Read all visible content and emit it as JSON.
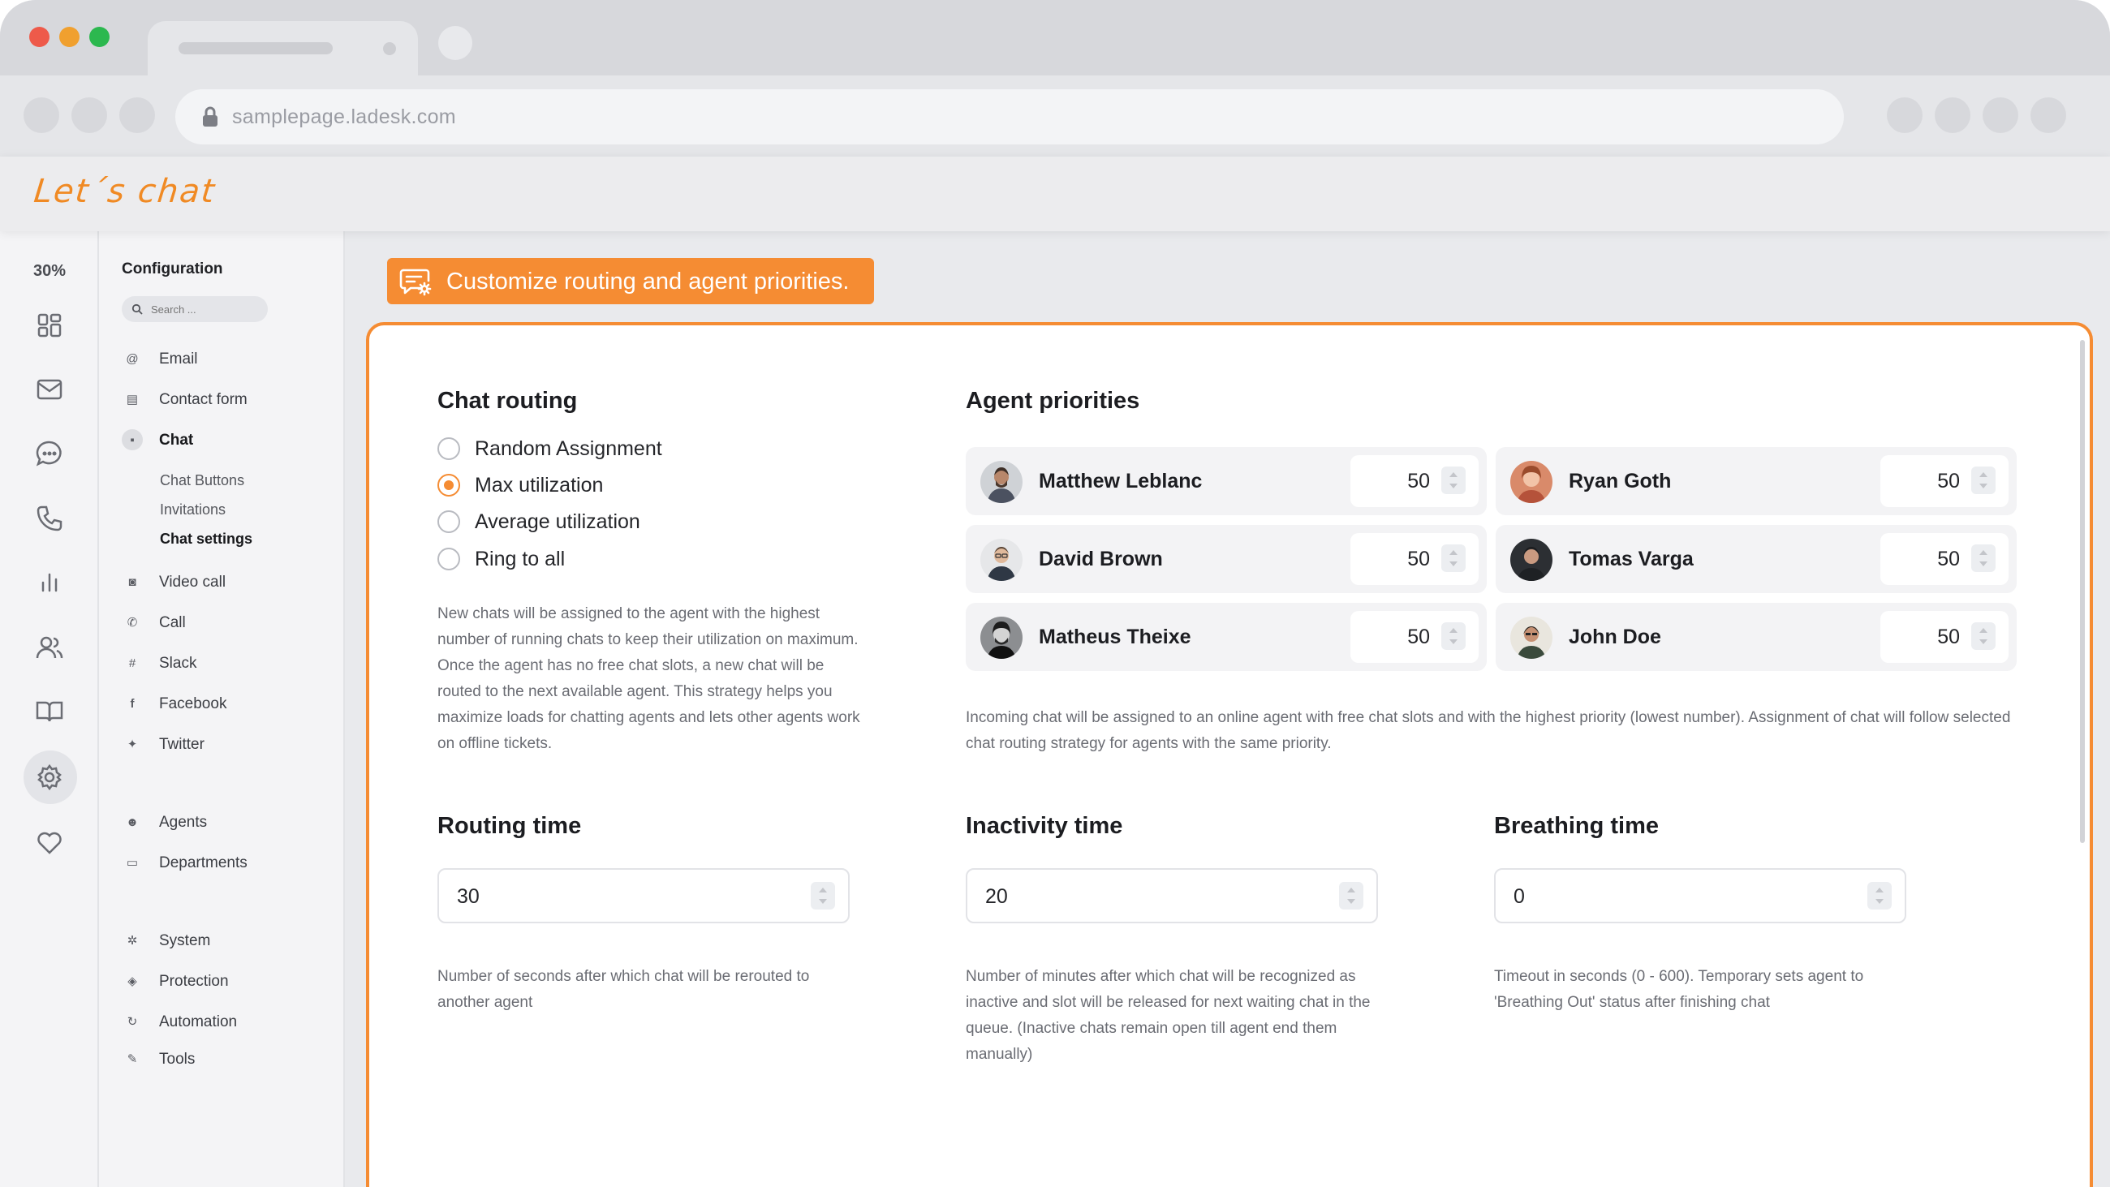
{
  "browser": {
    "url": "samplepage.ladesk.com",
    "traffic_colors": [
      "#ee5a4a",
      "#f0a02f",
      "#2cb84f"
    ]
  },
  "app": {
    "logo": "Let´s chat"
  },
  "rail": {
    "percent": "30%",
    "icons": [
      "dashboard-icon",
      "mail-icon",
      "chat-icon",
      "phone-icon",
      "reports-icon",
      "contacts-icon",
      "knowledgebase-icon",
      "settings-icon",
      "heart-icon"
    ],
    "active": "settings-icon"
  },
  "config": {
    "title": "Configuration",
    "search_placeholder": "Search ...",
    "items": [
      {
        "label": "Email",
        "icon": "at-icon"
      },
      {
        "label": "Contact form",
        "icon": "form-icon"
      },
      {
        "label": "Chat",
        "icon": "chat-bubble-icon",
        "active": true
      },
      {
        "label": "Video call",
        "icon": "video-icon"
      },
      {
        "label": "Call",
        "icon": "phone-icon"
      },
      {
        "label": "Slack",
        "icon": "slack-icon"
      },
      {
        "label": "Facebook",
        "icon": "facebook-icon"
      },
      {
        "label": "Twitter",
        "icon": "twitter-icon"
      },
      {
        "label": "Agents",
        "icon": "agents-icon"
      },
      {
        "label": "Departments",
        "icon": "folder-icon"
      },
      {
        "label": "System",
        "icon": "gear-icon"
      },
      {
        "label": "Protection",
        "icon": "shield-icon"
      },
      {
        "label": "Automation",
        "icon": "automation-icon"
      },
      {
        "label": "Tools",
        "icon": "wrench-icon"
      }
    ],
    "chat_sub": [
      "Chat Buttons",
      "Invitations",
      "Chat settings"
    ],
    "chat_sub_active": "Chat settings"
  },
  "banner": {
    "text": "Customize routing and agent priorities.",
    "accent": "#f58c33"
  },
  "chat_routing": {
    "title": "Chat routing",
    "options": [
      "Random Assignment",
      "Max utilization",
      "Average utilization",
      "Ring to all"
    ],
    "selected": "Max utilization",
    "description": "New chats will be assigned to the agent with the highest number of running chats to keep their utilization on maximum. Once the agent has no free chat slots, a new chat will be routed to the next available agent. This strategy helps you maximize loads for chatting agents and lets other agents work on offline tickets."
  },
  "agent_priorities": {
    "title": "Agent priorities",
    "agents": [
      {
        "name": "Matthew Leblanc",
        "priority": "50"
      },
      {
        "name": "Ryan Goth",
        "priority": "50"
      },
      {
        "name": "David Brown",
        "priority": "50"
      },
      {
        "name": "Tomas Varga",
        "priority": "50"
      },
      {
        "name": "Matheus Theixe",
        "priority": "50"
      },
      {
        "name": "John Doe",
        "priority": "50"
      }
    ],
    "description": "Incoming chat will be assigned to an online agent with free chat slots and with the highest priority (lowest number). Assignment of chat will follow selected chat routing strategy for agents with the same priority."
  },
  "routing_time": {
    "title": "Routing time",
    "value": "30",
    "description": "Number of seconds after which chat will be rerouted to another agent"
  },
  "inactivity_time": {
    "title": "Inactivity time",
    "value": "20",
    "description": "Number of minutes after which chat will be recognized as inactive and slot will be released for next waiting chat in the queue. (Inactive chats remain open till agent end them manually)"
  },
  "breathing_time": {
    "title": "Breathing time",
    "value": "0",
    "description": "Timeout in seconds (0 - 600). Temporary sets agent to 'Breathing Out' status after finishing chat"
  }
}
